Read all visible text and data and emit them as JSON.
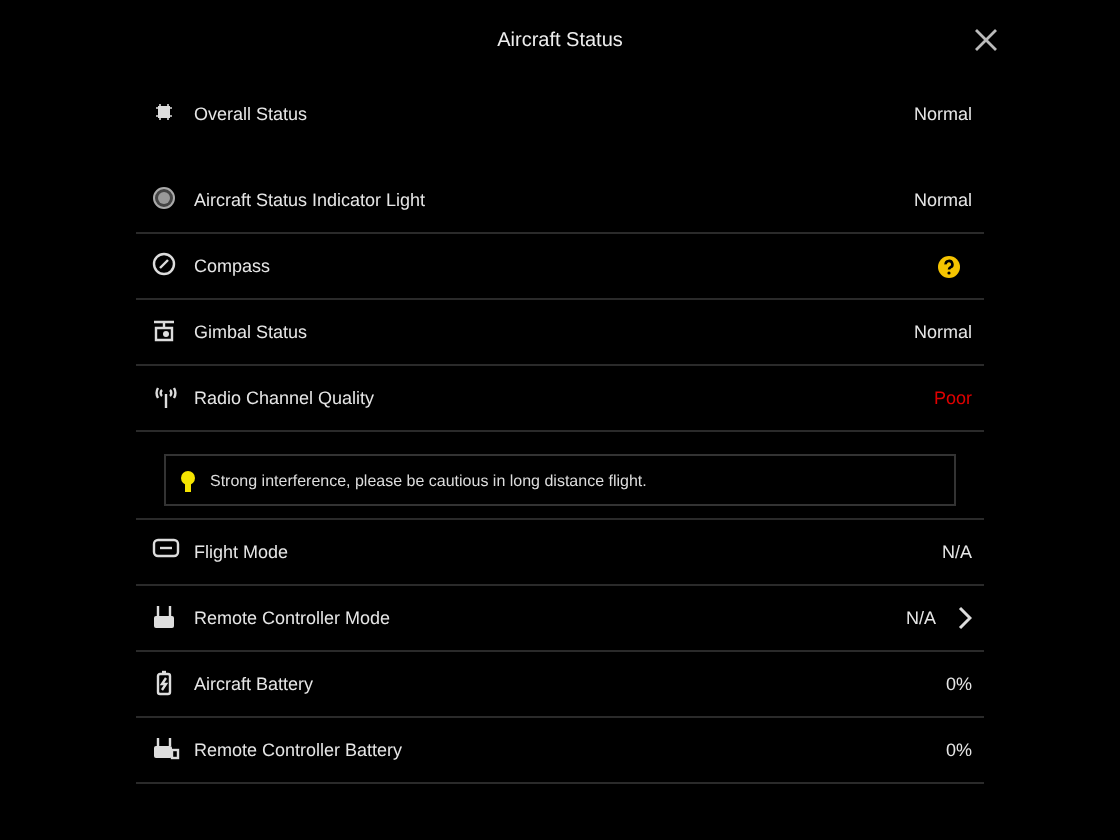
{
  "header": {
    "title": "Aircraft Status"
  },
  "overall": {
    "label": "Overall Status",
    "value": "Normal"
  },
  "rows": [
    {
      "label": "Aircraft Status Indicator Light",
      "kind": "text",
      "value": "Normal",
      "color": "#e6e6e6",
      "expandable": false
    },
    {
      "label": "Compass",
      "kind": "help",
      "color": "#f5c400",
      "expandable": false
    },
    {
      "label": "Gimbal Status",
      "kind": "text",
      "value": "Normal",
      "color": "#e6e6e6",
      "expandable": false
    },
    {
      "label": "Radio Channel Quality",
      "kind": "text",
      "value": "Poor",
      "color": "#e00000",
      "expandable": false,
      "tip": "Strong interference, please be cautious in long distance flight."
    },
    {
      "label": "Flight Mode",
      "kind": "text",
      "value": "N/A",
      "color": "#e6e6e6",
      "expandable": false
    },
    {
      "label": "Remote Controller Mode",
      "kind": "text",
      "value": "N/A",
      "color": "#e6e6e6",
      "expandable": true
    },
    {
      "label": "Aircraft Battery",
      "kind": "text",
      "value": "0%",
      "color": "#e6e6e6",
      "expandable": false
    },
    {
      "label": "Remote Controller Battery",
      "kind": "text",
      "value": "0%",
      "color": "#e6e6e6",
      "expandable": false
    }
  ]
}
